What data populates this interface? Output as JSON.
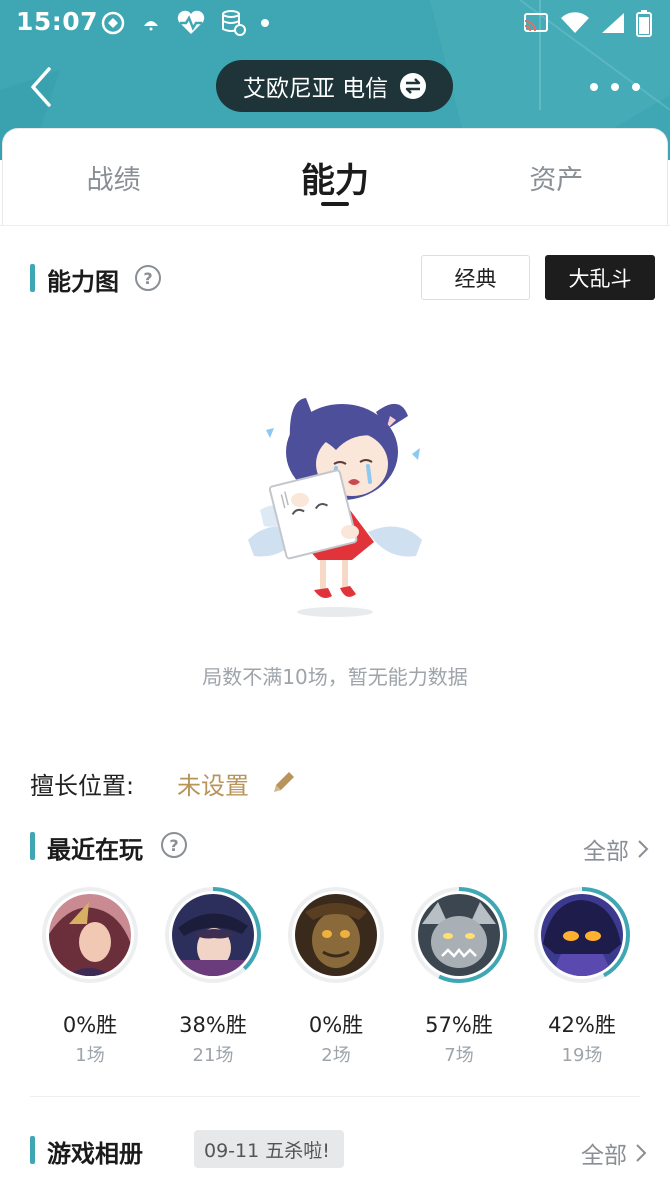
{
  "status_bar": {
    "time": "15:07"
  },
  "header": {
    "server_label": "艾欧尼亚 电信"
  },
  "tabs": [
    {
      "label": "战绩",
      "active": false
    },
    {
      "label": "能力",
      "active": true
    },
    {
      "label": "资产",
      "active": false
    }
  ],
  "ability": {
    "title": "能力图",
    "modes": {
      "classic": "经典",
      "aram": "大乱斗",
      "selected": "大乱斗"
    },
    "empty_message": "局数不满10场，暂无能力数据"
  },
  "position": {
    "label": "擅长位置:",
    "value": "未设置"
  },
  "recent": {
    "title": "最近在玩",
    "all_label": "全部",
    "champions": [
      {
        "winrate": "0%胜",
        "games": "1场",
        "win_fraction": 0.0
      },
      {
        "winrate": "38%胜",
        "games": "21场",
        "win_fraction": 0.38
      },
      {
        "winrate": "0%胜",
        "games": "2场",
        "win_fraction": 0.0
      },
      {
        "winrate": "57%胜",
        "games": "7场",
        "win_fraction": 0.57
      },
      {
        "winrate": "42%胜",
        "games": "19场",
        "win_fraction": 0.42
      }
    ]
  },
  "album": {
    "title": "游戏相册",
    "tag": "09-11 五杀啦!",
    "all_label": "全部"
  },
  "colors": {
    "accent": "#3ea7b3",
    "gold": "#b8945a",
    "dark": "#1d1d1d",
    "muted": "#9ea4aa"
  }
}
